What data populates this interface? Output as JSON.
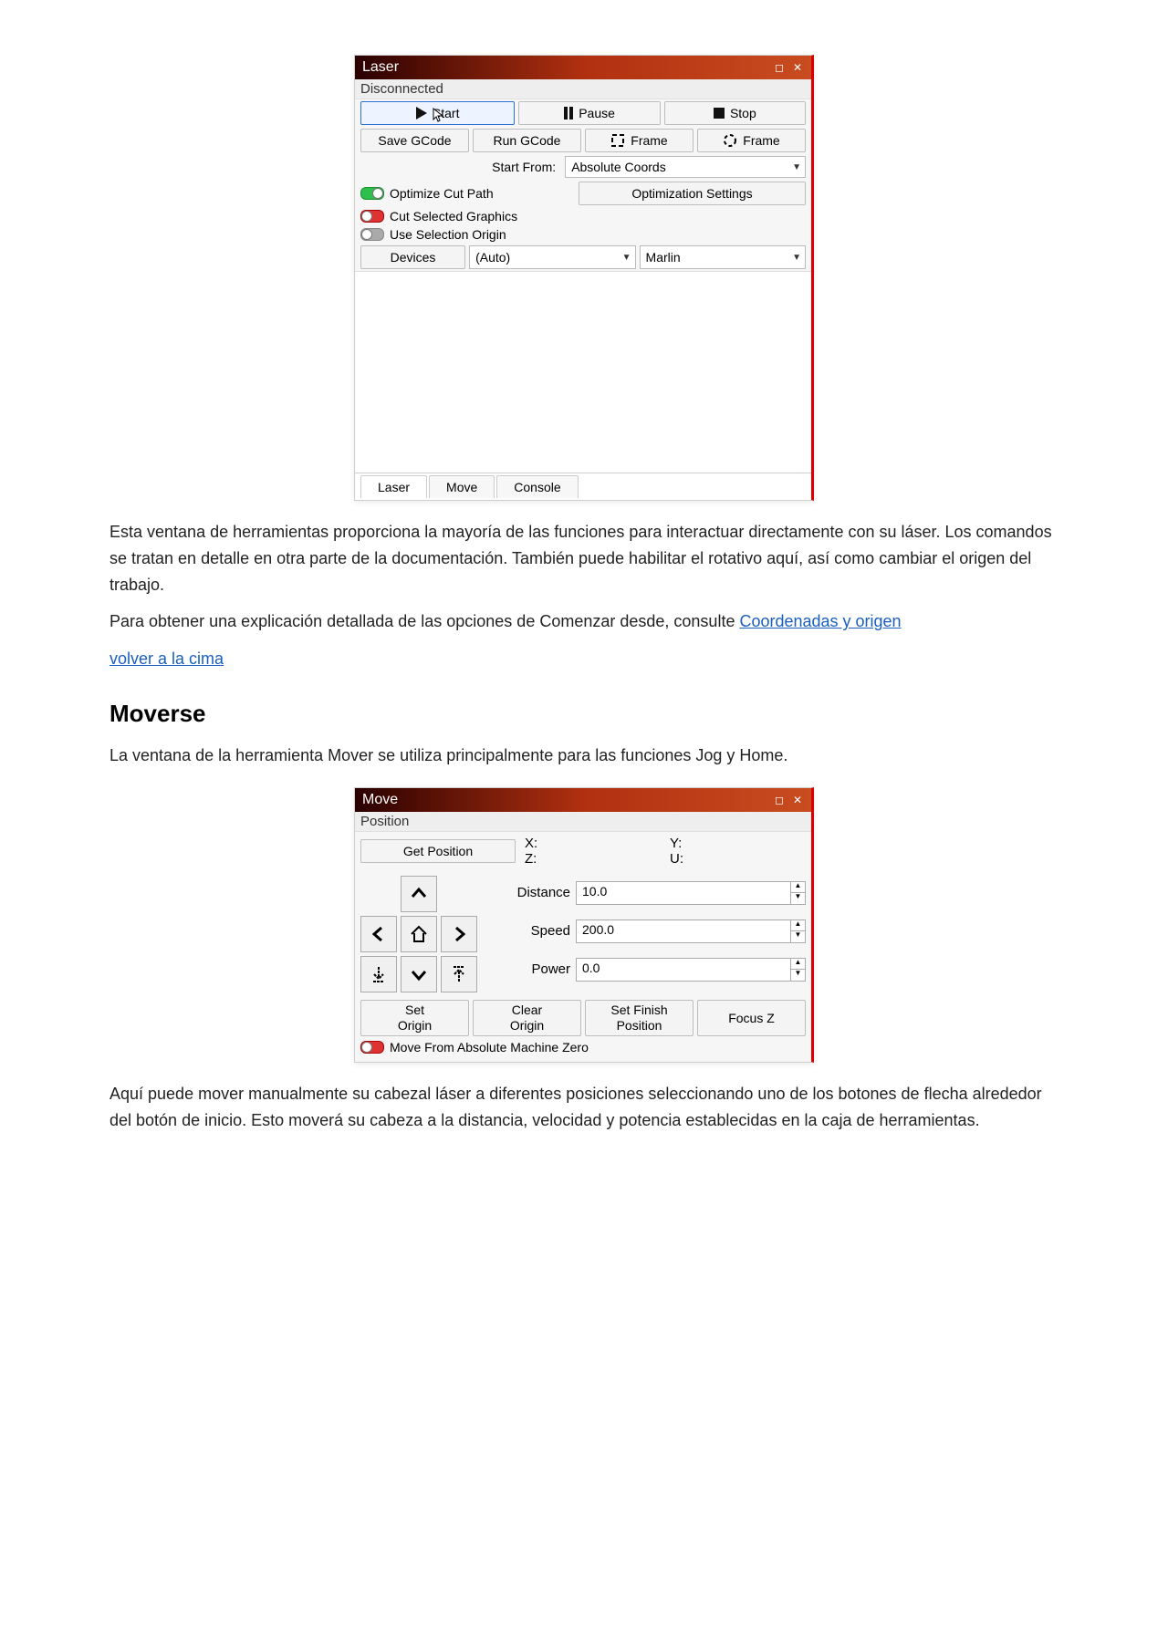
{
  "laserPanel": {
    "title": "Laser",
    "status": "Disconnected",
    "buttons": {
      "start": "Start",
      "pause": "Pause",
      "stop": "Stop",
      "saveGcode": "Save GCode",
      "runGcode": "Run GCode",
      "frameRect": "Frame",
      "frameCircle": "Frame",
      "devices": "Devices"
    },
    "startFromLabel": "Start From:",
    "startFromValue": "Absolute Coords",
    "optimizationSettings": "Optimization Settings",
    "toggles": {
      "optimize": "Optimize Cut Path",
      "cutSelected": "Cut Selected Graphics",
      "useSelectionOrigin": "Use Selection Origin"
    },
    "portValue": "(Auto)",
    "deviceValue": "Marlin",
    "tabs": {
      "laser": "Laser",
      "move": "Move",
      "console": "Console"
    }
  },
  "text": {
    "para1": "Esta ventana de herramientas proporciona la mayoría de las funciones para interactuar directamente con su láser. Los comandos se tratan en detalle en otra parte de la documentación. También puede habilitar el rotativo aquí, así como cambiar el origen del trabajo.",
    "para2a": "Para obtener una explicación detallada de las opciones de Comenzar desde, consulte ",
    "coordsLink": "Coordenadas y origen",
    "backToTop": "volver a la cima",
    "moveHeading": "Moverse",
    "para3": "La ventana de la herramienta Mover se utiliza principalmente para las funciones Jog y Home.",
    "para4": "Aquí puede mover manualmente su cabezal láser a diferentes posiciones seleccionando uno de los botones de flecha alrededor del botón de inicio. Esto moverá su cabeza a la distancia, velocidad y potencia establecidas en la caja de herramientas."
  },
  "movePanel": {
    "title": "Move",
    "positionLabel": "Position",
    "getPosition": "Get Position",
    "axes": {
      "x": "X:",
      "y": "Y:",
      "z": "Z:",
      "u": "U:"
    },
    "fields": {
      "distanceLabel": "Distance",
      "distanceValue": "10.0",
      "speedLabel": "Speed",
      "speedValue": "200.0",
      "powerLabel": "Power",
      "powerValue": "0.0"
    },
    "buttons": {
      "setOrigin": "Set\nOrigin",
      "clearOrigin": "Clear\nOrigin",
      "setFinish": "Set Finish\nPosition",
      "focusZ": "Focus Z"
    },
    "toggle": "Move From Absolute Machine Zero"
  }
}
